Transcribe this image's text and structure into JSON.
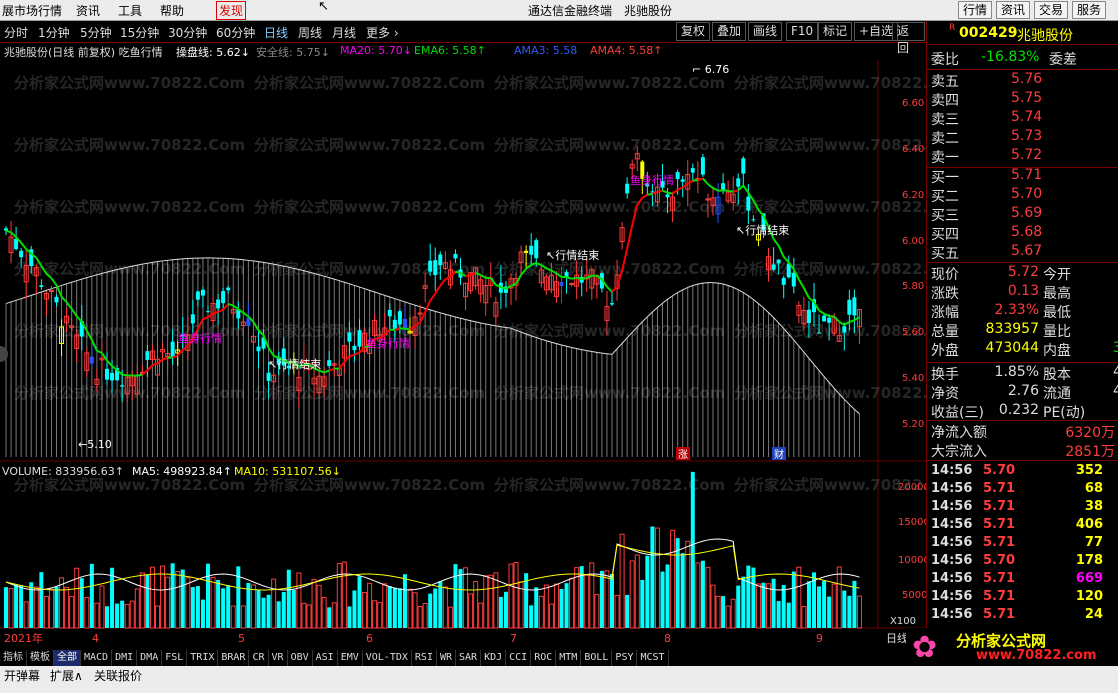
{
  "menubar": {
    "items": [
      "展市场行情",
      "资讯",
      "工具",
      "帮助",
      "发现"
    ],
    "center_title": "通达信金融终端",
    "stock_title": "兆驰股份",
    "right_buttons": [
      "行情",
      "资讯",
      "交易",
      "服务"
    ]
  },
  "periods": [
    "分时",
    "1分钟",
    "5分钟",
    "15分钟",
    "30分钟",
    "60分钟",
    "日线",
    "周线",
    "月线",
    "更多 ›"
  ],
  "active_period": "日线",
  "toolbar_buttons": [
    "复权",
    "叠加",
    "画线",
    "F10",
    "标记",
    "+自选",
    "返回"
  ],
  "indicator_line": {
    "title": "兆驰股份(日线 前复权) 吃鱼行情",
    "caopan": "操盘线: 5.62↓",
    "anquan": "安全线: 5.75↓",
    "ma20": "MA20: 5.70↓",
    "ema6": "EMA6: 5.58↑",
    "ama3": "AMA3: 5.58",
    "ama4": "AMA4: 5.58↑"
  },
  "chart_annotations": {
    "high_label": "6.76",
    "low_label": "5.10",
    "yu_shen_1": "鱼身行情",
    "yu_shen_2": "鱼身行情",
    "yu_shen_3": "鱼身行情",
    "end_1": "行情结束",
    "end_2": "行情结束",
    "end_3": "行情结束",
    "zhang_marker": "涨",
    "cai_marker": "财"
  },
  "price_axis": [
    "6.60",
    "6.40",
    "6.20",
    "6.00",
    "5.80",
    "5.60",
    "5.40",
    "5.20"
  ],
  "volume_line": {
    "volume": "VOLUME: 833956.63↑",
    "ma5": "MA5: 498923.84↑",
    "ma10": "MA10: 531107.56↓"
  },
  "volume_axis": [
    "20000",
    "15000",
    "10000",
    "5000"
  ],
  "volume_axis_unit": "X100",
  "date_axis": [
    "2021年",
    "4",
    "5",
    "6",
    "7",
    "8",
    "9"
  ],
  "date_axis_corner": "日线",
  "watermark": "分析家公式网www.70822.Com",
  "right_panel": {
    "marker": "R",
    "code": "002429",
    "name": "兆驰股份",
    "weibi_label": "委比",
    "weibi_value": "-16.83%",
    "weicha_label": "委差",
    "asks": [
      {
        "label": "卖五",
        "price": "5.76"
      },
      {
        "label": "卖四",
        "price": "5.75"
      },
      {
        "label": "卖三",
        "price": "5.74"
      },
      {
        "label": "卖二",
        "price": "5.73"
      },
      {
        "label": "卖一",
        "price": "5.72"
      }
    ],
    "bids": [
      {
        "label": "买一",
        "price": "5.71"
      },
      {
        "label": "买二",
        "price": "5.70"
      },
      {
        "label": "买三",
        "price": "5.69"
      },
      {
        "label": "买四",
        "price": "5.68"
      },
      {
        "label": "买五",
        "price": "5.67"
      }
    ],
    "stats": [
      {
        "l1": "现价",
        "v1": "5.72",
        "l2": "今开"
      },
      {
        "l1": "涨跌",
        "v1": "0.13",
        "l2": "最高"
      },
      {
        "l1": "涨幅",
        "v1": "2.33%",
        "l2": "最低"
      },
      {
        "l1": "总量",
        "v1": "833957",
        "l2": "量比"
      },
      {
        "l1": "外盘",
        "v1": "473044",
        "l2": "内盘",
        "v2": "3"
      }
    ],
    "stats2": [
      {
        "l1": "换手",
        "v1": "1.85%",
        "l2": "股本",
        "v2": "4"
      },
      {
        "l1": "净资",
        "v1": "2.76",
        "l2": "流通",
        "v2": "4"
      },
      {
        "l1": "收益(三)",
        "v1": "0.232",
        "l2": "PE(动)"
      }
    ],
    "flows": [
      {
        "label": "净流入额",
        "value": "6320万"
      },
      {
        "label": "大宗流入",
        "value": "2851万"
      }
    ],
    "ticks": [
      {
        "time": "14:56",
        "price": "5.70",
        "vol": "352"
      },
      {
        "time": "14:56",
        "price": "5.71",
        "vol": "68"
      },
      {
        "time": "14:56",
        "price": "5.71",
        "vol": "38"
      },
      {
        "time": "14:56",
        "price": "5.71",
        "vol": "406"
      },
      {
        "time": "14:56",
        "price": "5.71",
        "vol": "77"
      },
      {
        "time": "14:56",
        "price": "5.70",
        "vol": "178"
      },
      {
        "time": "14:56",
        "price": "5.71",
        "vol": "669"
      },
      {
        "time": "14:56",
        "price": "5.71",
        "vol": "120"
      },
      {
        "time": "14:56",
        "price": "5.71",
        "vol": "24"
      }
    ],
    "logo_text": "分析家公式网",
    "logo_url": "www.70822.com"
  },
  "tabs": [
    "指标",
    "模板",
    "全部",
    "MACD",
    "DMI",
    "DMA",
    "FSL",
    "TRIX",
    "BRAR",
    "CR",
    "VR",
    "OBV",
    "ASI",
    "EMV",
    "VOL-TDX",
    "RSI",
    "WR",
    "SAR",
    "KDJ",
    "CCI",
    "ROC",
    "MTM",
    "BOLL",
    "PSY",
    "MCST"
  ],
  "active_tab": "全部",
  "statusbar": [
    "开弹幕",
    "扩展∧",
    "关联报价"
  ],
  "colors": {
    "up": "#ff3c3c",
    "down": "#00ffff",
    "green_line": "#00e000",
    "red_line": "#ff0000",
    "label_magenta": "#ff00ff",
    "volume_ma5": "#ffffff",
    "volume_ma10": "#ffff00",
    "ask_green": "#00e000",
    "price_yellow": "#ffff00"
  }
}
